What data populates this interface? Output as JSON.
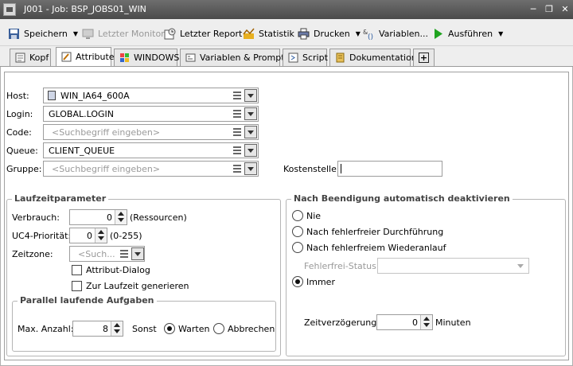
{
  "window": {
    "title": "J001 - Job: BSP_JOBS01_WIN",
    "controls": [
      "minimize-icon",
      "restore-icon",
      "close-icon"
    ]
  },
  "toolbar": {
    "save": "Speichern",
    "last_monitor": "Letzter Monitor",
    "last_report": "Letzter Report",
    "statistics": "Statistik",
    "print": "Drucken",
    "variables": "Variablen...",
    "execute": "Ausführen"
  },
  "tabs": [
    "Kopf",
    "Attribute",
    "WINDOWS",
    "Variablen & Prompts",
    "Script",
    "Dokumentation"
  ],
  "active_tab": "Attribute",
  "form": {
    "host": {
      "label": "Host:",
      "value": "WIN_IA64_600A"
    },
    "login": {
      "label": "Login:",
      "value": "GLOBAL.LOGIN"
    },
    "code": {
      "label": "Code:",
      "placeholder": "<Suchbegriff eingeben>"
    },
    "queue": {
      "label": "Queue:",
      "value": "CLIENT_QUEUE"
    },
    "group": {
      "label": "Gruppe:",
      "placeholder": "<Suchbegriff eingeben>"
    },
    "cost_center": {
      "label": "Kostenstelle:",
      "value": ""
    }
  },
  "runtime": {
    "title": "Laufzeitparameter",
    "consumption_label": "Verbrauch:",
    "consumption_value": "0",
    "consumption_unit": "(Ressourcen)",
    "priority_label": "UC4-Priorität:",
    "priority_value": "0",
    "priority_range": "(0-255)",
    "timezone_label": "Zeitzone:",
    "timezone_placeholder": "<Such...",
    "attribute_dialog": "Attribut-Dialog",
    "generate_runtime": "Zur Laufzeit generieren"
  },
  "parallel": {
    "title": "Parallel laufende Aufgaben",
    "max_label": "Max. Anzahl:",
    "max_value": "8",
    "else_label": "Sonst",
    "wait": "Warten",
    "abort": "Abbrechen",
    "selected": "Warten"
  },
  "deactivate": {
    "title": "Nach Beendigung automatisch deaktivieren",
    "options": [
      "Nie",
      "Nach fehlerfreier Durchführung",
      "Nach fehlerfreiem Wiederanlauf",
      "Immer"
    ],
    "selected": "Immer",
    "status_label": "Fehlerfrei-Status:",
    "delay_label": "Zeitverzögerung:",
    "delay_value": "0",
    "delay_unit": "Minuten"
  }
}
